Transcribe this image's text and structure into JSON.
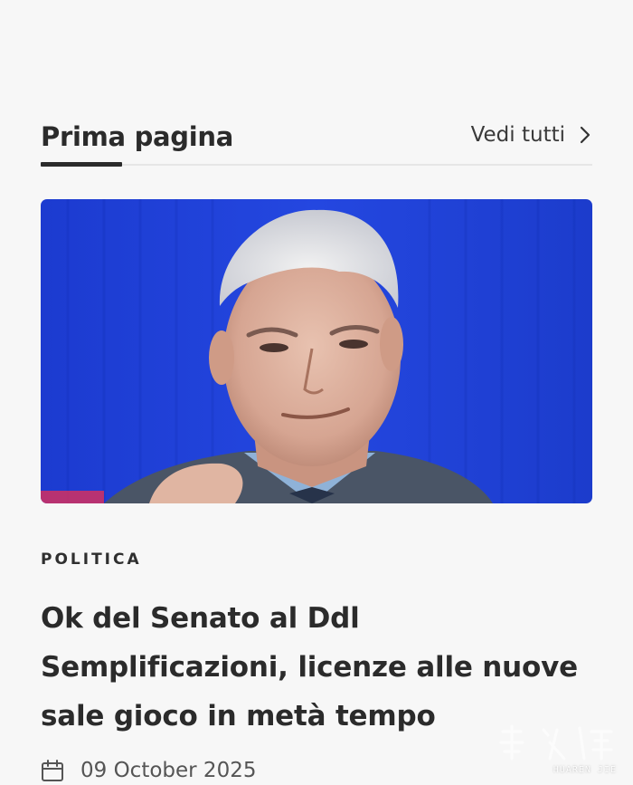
{
  "section": {
    "title": "Prima pagina",
    "see_all_label": "Vedi tutti"
  },
  "article": {
    "category": "POLITICA",
    "headline": "Ok del Senato al Ddl Semplificazioni, licenze alle nuove sale gioco in metà tempo",
    "date": "09 October 2025"
  },
  "watermark": {
    "text": "HUAREN JIE"
  },
  "icons": {
    "see_all": "chevron-right-icon",
    "date": "calendar-icon"
  },
  "colors": {
    "background": "#f7f7f7",
    "text": "#2b2b2b",
    "hero_backdrop": "#1f3fd6"
  }
}
